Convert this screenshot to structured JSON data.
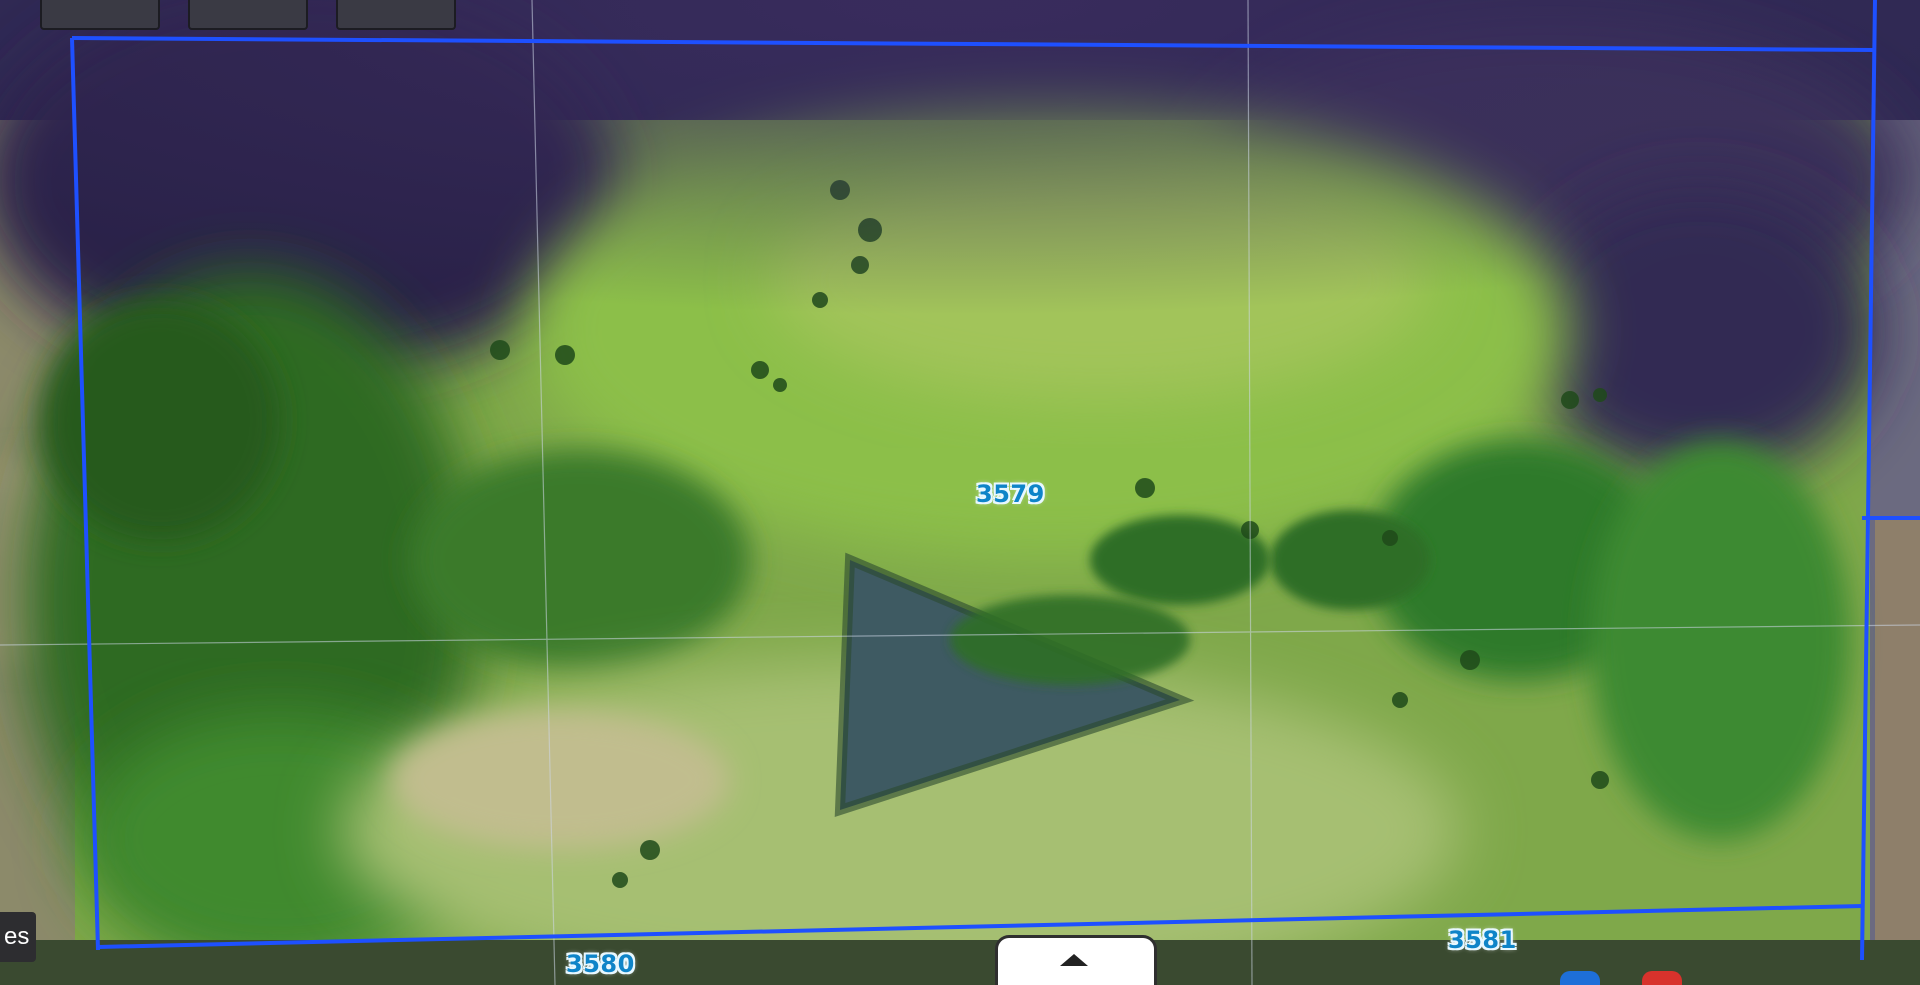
{
  "map": {
    "parcels": [
      {
        "id": "3579"
      },
      {
        "id": "3580"
      },
      {
        "id": "3581"
      }
    ],
    "side_tab_text": "es",
    "collapse_icon": "chevron-up-icon"
  },
  "colors": {
    "boundary": "#1e50ff",
    "label_text": "#0e84c8",
    "pond": "#3e5a62"
  }
}
